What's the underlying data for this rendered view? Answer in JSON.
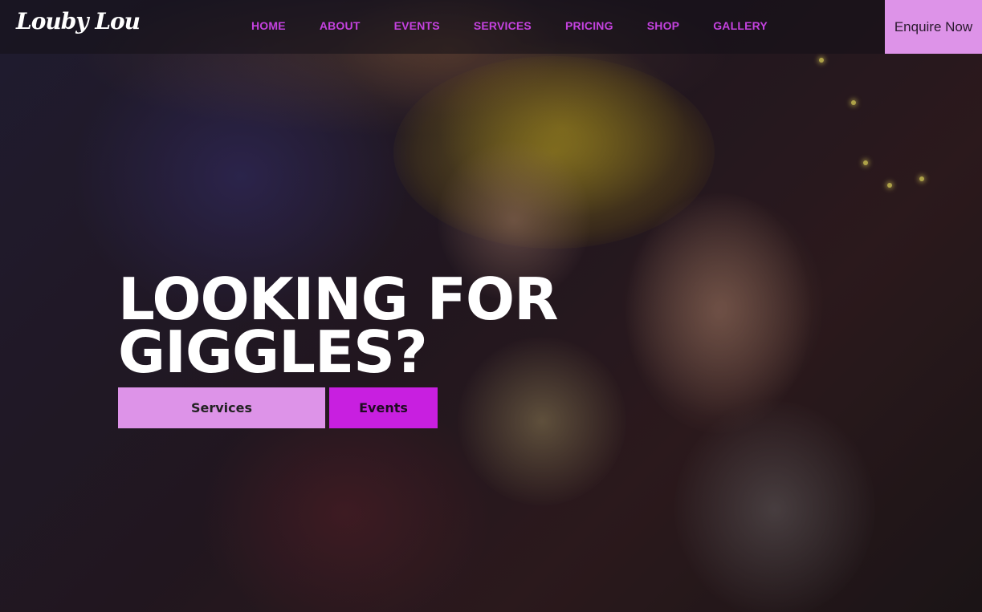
{
  "brand": {
    "logo_text": "Louby Lou"
  },
  "nav": {
    "items": [
      {
        "label": "HOME"
      },
      {
        "label": "ABOUT"
      },
      {
        "label": "EVENTS"
      },
      {
        "label": "SERVICES"
      },
      {
        "label": "PRICING"
      },
      {
        "label": "SHOP"
      },
      {
        "label": "GALLERY"
      }
    ],
    "cta_label": "Enquire Now"
  },
  "hero": {
    "headline": "LOOKING FOR GIGGLES?",
    "buttons": {
      "services_label": "Services",
      "events_label": "Events"
    }
  },
  "colors": {
    "nav_link": "#c542e0",
    "enquire_bg": "#dd93e8",
    "services_bg": "#dd93e8",
    "events_bg": "#c81fe0",
    "headline": "#ffffff"
  }
}
